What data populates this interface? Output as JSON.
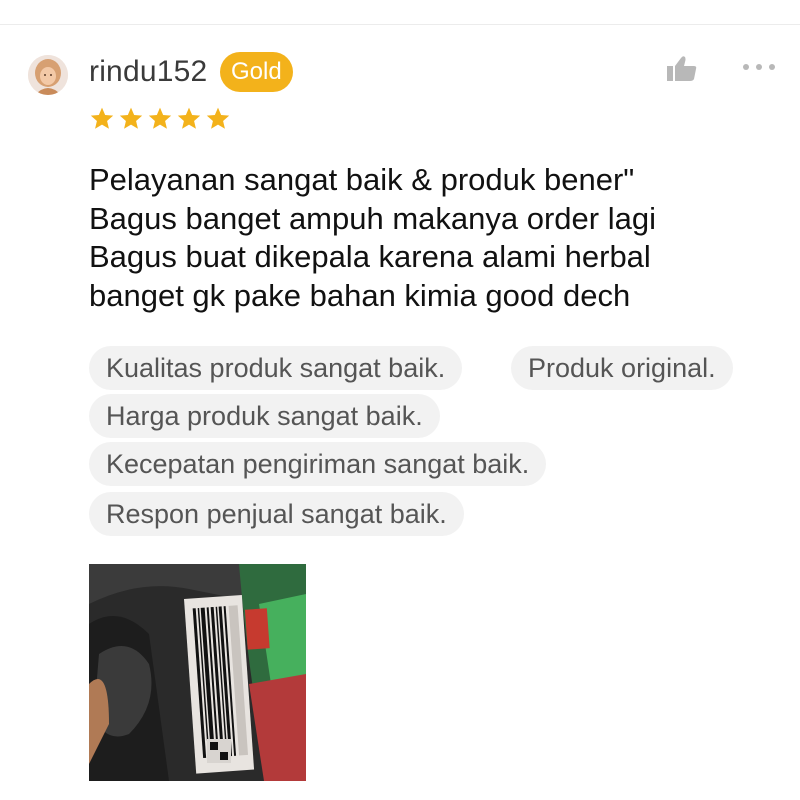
{
  "review": {
    "username": "rindu152",
    "badge": "Gold",
    "rating": 5,
    "text": "Pelayanan sangat baik & produk bener\"\nBagus banget ampuh makanya order lagi\nBagus buat dikepala karena alami herbal\nbanget gk pake bahan kimia good dech",
    "tags": [
      "Kualitas produk sangat baik.",
      "Produk original.",
      "Harga produk sangat baik.",
      "Kecepatan pengiriman sangat baik.",
      "Respon penjual sangat baik."
    ]
  },
  "icons": {
    "avatar": "user-avatar",
    "like": "thumbs-up-icon",
    "more": "more-dots-icon",
    "star": "star-icon"
  },
  "colors": {
    "badge": "#f3b21b",
    "star": "#f3b21b",
    "chip_bg": "#f2f2f2",
    "icon_gray": "#b8b8b8"
  }
}
